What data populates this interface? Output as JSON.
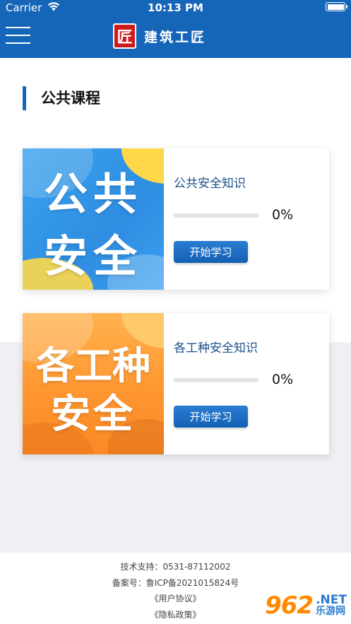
{
  "status_bar": {
    "carrier": "Carrier",
    "time": "10:13 PM"
  },
  "header": {
    "logo_char": "匠",
    "title": "建筑工匠"
  },
  "section": {
    "title": "公共课程"
  },
  "courses": [
    {
      "thumb_line1": "公共",
      "thumb_line2": "安全",
      "title": "公共安全知识",
      "progress": 0,
      "progress_text": "0%",
      "button_label": "开始学习"
    },
    {
      "thumb_line1": "各工种",
      "thumb_line2": "安全",
      "title": "各工种安全知识",
      "progress": 0,
      "progress_text": "0%",
      "button_label": "开始学习"
    }
  ],
  "footer": {
    "support": "技术支持：0531-87112002",
    "icp": "备案号：鲁ICP备2021015824号",
    "user_agreement": "《用户协议》",
    "privacy_policy": "《隐私政策》"
  },
  "watermark": {
    "number": "962",
    "net": ".NET",
    "site": "乐游网"
  },
  "colors": {
    "brand_blue": "#1565b8",
    "logo_red": "#d0191c"
  }
}
